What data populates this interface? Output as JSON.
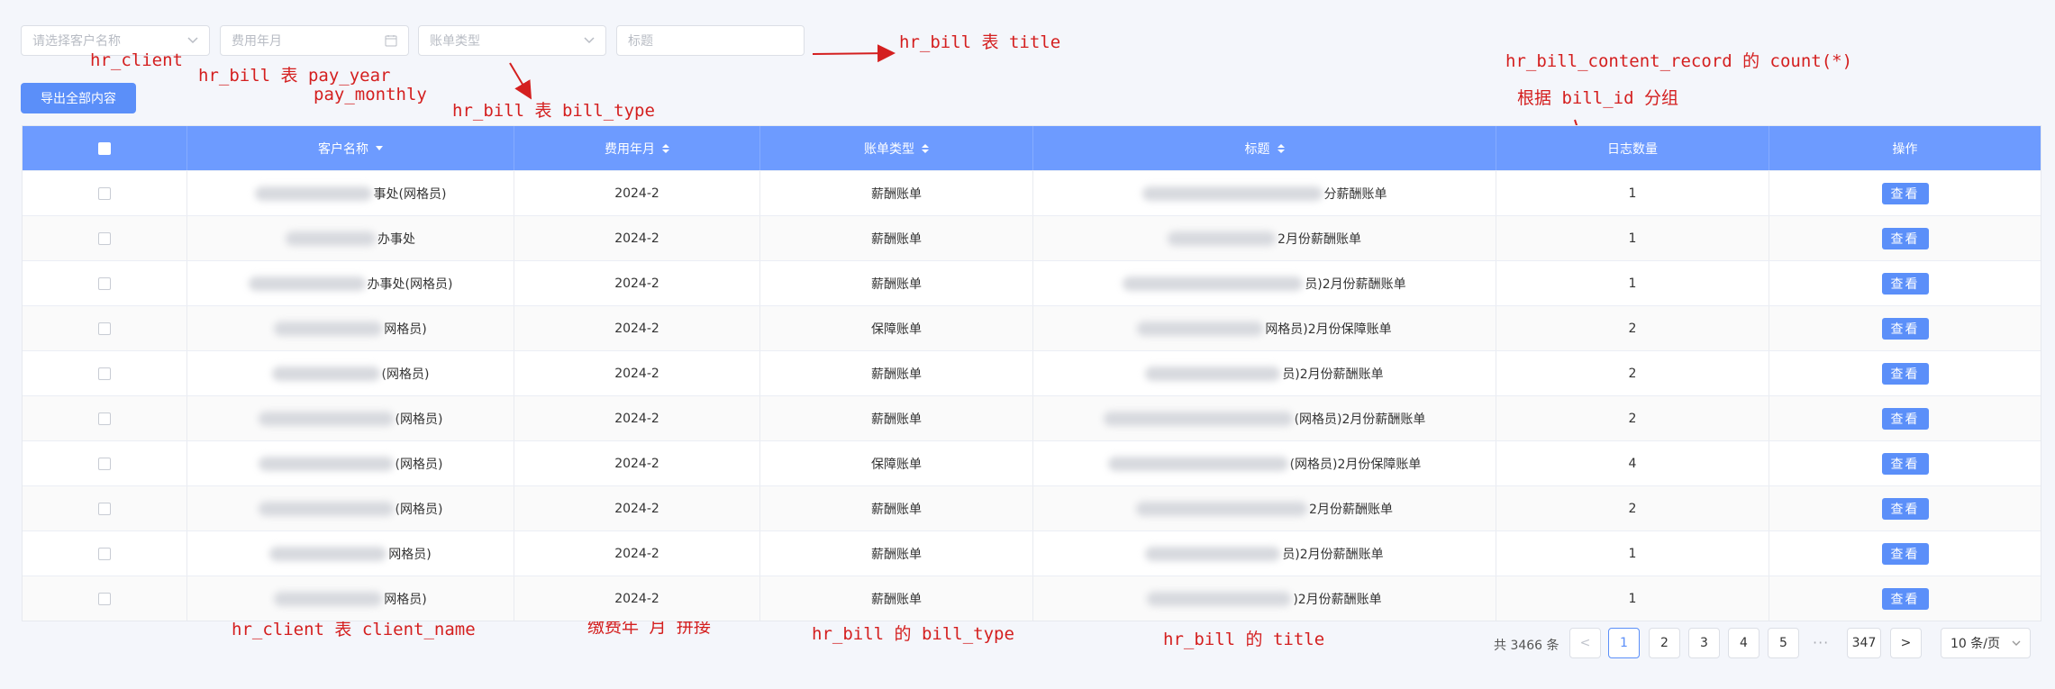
{
  "filters": {
    "client_placeholder": "请选择客户名称",
    "year_placeholder": "费用年月",
    "type_placeholder": "账单类型",
    "title_placeholder": "标题"
  },
  "toolbar": {
    "export_label": "导出全部内容"
  },
  "annotations": {
    "hr_client": "hr_client",
    "pay_year": "hr_bill 表 pay_year",
    "pay_monthly": "pay_monthly",
    "bill_type": "hr_bill 表 bill_type",
    "title": "hr_bill 表 title",
    "count": "hr_bill_content_record 的 count(*)",
    "group_by": "根据 bill_id 分组",
    "client_name": "hr_client 表 client_name",
    "concat": "缴费年 月 拼接",
    "bill_type2": "hr_bill 的 bill_type",
    "title2": "hr_bill 的 title"
  },
  "table": {
    "columns": [
      "",
      "客户名称",
      "费用年月",
      "账单类型",
      "标题",
      "日志数量",
      "操作"
    ],
    "view_label": "查看",
    "rows": [
      {
        "client": "事处(网格员)",
        "period": "2024-2",
        "type": "薪酬账单",
        "title": "分薪酬账单",
        "count": "1"
      },
      {
        "client": "办事处",
        "period": "2024-2",
        "type": "薪酬账单",
        "title": "2月份薪酬账单",
        "count": "1"
      },
      {
        "client": "办事处(网格员)",
        "period": "2024-2",
        "type": "薪酬账单",
        "title": "员)2月份薪酬账单",
        "count": "1"
      },
      {
        "client": "网格员)",
        "period": "2024-2",
        "type": "保障账单",
        "title": "网格员)2月份保障账单",
        "count": "2"
      },
      {
        "client": "(网格员)",
        "period": "2024-2",
        "type": "薪酬账单",
        "title": "员)2月份薪酬账单",
        "count": "2"
      },
      {
        "client": "(网格员)",
        "period": "2024-2",
        "type": "薪酬账单",
        "title": "(网格员)2月份薪酬账单",
        "count": "2"
      },
      {
        "client": "(网格员)",
        "period": "2024-2",
        "type": "保障账单",
        "title": "(网格员)2月份保障账单",
        "count": "4"
      },
      {
        "client": "(网格员)",
        "period": "2024-2",
        "type": "薪酬账单",
        "title": "2月份薪酬账单",
        "count": "2"
      },
      {
        "client": "网格员)",
        "period": "2024-2",
        "type": "薪酬账单",
        "title": "员)2月份薪酬账单",
        "count": "1"
      },
      {
        "client": "网格员)",
        "period": "2024-2",
        "type": "薪酬账单",
        "title": ")2月份薪酬账单",
        "count": "1"
      }
    ]
  },
  "pagination": {
    "total": "共 3466 条",
    "pages": [
      "1",
      "2",
      "3",
      "4",
      "5"
    ],
    "ellipsis": "···",
    "last": "347",
    "page_size": "10 条/页",
    "prev": "<",
    "next": ">"
  }
}
